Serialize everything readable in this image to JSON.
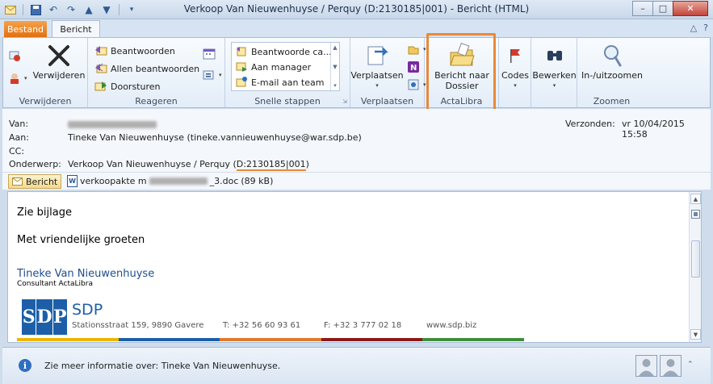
{
  "window": {
    "title": "Verkoop Van Nieuwenhuyse / Perquy (D:2130185|001)  -  Bericht (HTML)"
  },
  "tabs": {
    "file": "Bestand",
    "message": "Bericht"
  },
  "ribbon": {
    "groups": {
      "delete": {
        "label": "Verwijderen",
        "delete_button": "Verwijderen"
      },
      "respond": {
        "label": "Reageren",
        "reply": "Beantwoorden",
        "reply_all": "Allen beantwoorden",
        "forward": "Doorsturen"
      },
      "quick_steps": {
        "label": "Snelle stappen",
        "items": [
          "Beantwoorde ca...",
          "Aan manager",
          "E-mail aan team"
        ]
      },
      "move": {
        "label": "Verplaatsen",
        "move_button": "Verplaatsen"
      },
      "actalibra": {
        "label": "ActaLibra",
        "button_line1": "Bericht naar",
        "button_line2": "Dossier"
      },
      "tags": {
        "button": "Codes"
      },
      "editing": {
        "button": "Bewerken"
      },
      "zoom": {
        "label": "Zoomen",
        "button": "In-/uitzoomen"
      }
    }
  },
  "header": {
    "from_label": "Van:",
    "to_label": "Aan:",
    "to_value": "Tineke Van Nieuwenhuyse (tineke.vannieuwenhuyse@war.sdp.be)",
    "cc_label": "CC:",
    "subject_label": "Onderwerp:",
    "subject_prefix": "Verkoop Van Nieuwenhuyse / Perquy (",
    "subject_code": "D:2130185|001",
    "subject_suffix": ")",
    "sent_label": "Verzonden:",
    "sent_value": "vr 10/04/2015 15:58"
  },
  "attachments": {
    "message_tab": "Bericht",
    "file_prefix": "verkoopakte m",
    "file_suffix": "_3.doc",
    "file_size": "(89 kB)"
  },
  "body": {
    "line1": "Zie bijlage",
    "line2": "Met vriendelijke groeten",
    "signature_name": "Tineke Van Nieuwenhuyse",
    "signature_role": "Consultant ActaLibra",
    "logo_letters": [
      "S",
      "D",
      "P"
    ],
    "logo_word": "SDP",
    "address": "Stationsstraat 159, 9890 Gavere",
    "phone": "T: +32 56 60 93 61",
    "fax": "F: +32 3 777 02 18",
    "website": "www.sdp.biz"
  },
  "footer": {
    "info_text": "Zie meer informatie over: Tineke Van Nieuwenhuyse."
  },
  "colors": {
    "accent_orange": "#e8893a",
    "sdp_blue": "#1c5fa8",
    "bar": [
      "#f0b400",
      "#1c5fa8",
      "#e07b2c",
      "#8b1a1a",
      "#3f8f3a"
    ]
  }
}
